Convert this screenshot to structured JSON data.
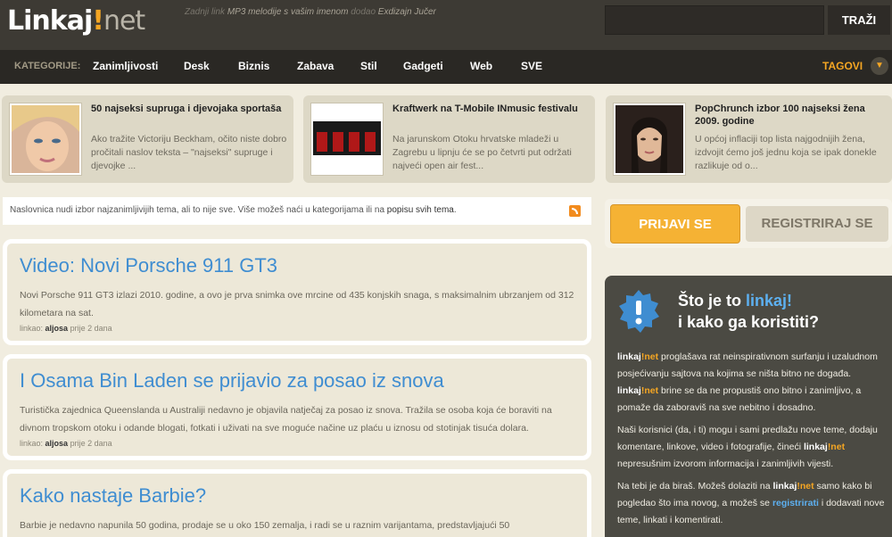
{
  "header": {
    "logo": {
      "part1": "Linkaj",
      "part2": "!",
      "part3": "net"
    },
    "latest": {
      "prefix": "Zadnji link",
      "item": "MP3 melodije s vašim imenom",
      "middle": "dodao",
      "user": "Exdizajn",
      "time": "Jučer"
    },
    "search": {
      "placeholder": "",
      "button_label": "TRAŽI"
    }
  },
  "nav": {
    "label": "KATEGORIJE:",
    "items": [
      "Zanimljivosti",
      "Desk",
      "Biznis",
      "Zabava",
      "Stil",
      "Gadgeti",
      "Web",
      "SVE"
    ],
    "tags_label": "TAGOVI",
    "tags_icon": "chevron-down-icon"
  },
  "featured": [
    {
      "title": "50 najseksi supruga i djevojaka sportaša",
      "desc": "Ako tražite Victoriju Beckham, očito niste dobro pročitali naslov teksta – \"najseksi\" supruge i djevojke ..."
    },
    {
      "title": "Kraftwerk na T-Mobile INmusic festivalu",
      "desc": "Na jarunskom Otoku hrvatske mladeži u Zagrebu u lipnju će se po četvrti put održati najveći open air fest..."
    },
    {
      "title": "PopChrunch izbor 100 najseksi žena 2009. godine",
      "desc": "U općoj inflaciji top lista najgodnijih žena, izdvojit ćemo još jednu koja se ipak donekle razlikuje od o..."
    }
  ],
  "info_bar": {
    "text": "Naslovnica nudi izbor najzanimljivijih tema, ali to nije sve. Više možeš naći u kategorijama ili na",
    "link": "popisu svih tema",
    "end": "."
  },
  "posts": [
    {
      "title": "Video: Novi Porsche 911 GT3",
      "body": "Novi Porsche 911 GT3 izlazi 2010. godine, a ovo je prva snimka ove mrcine od 435 konjskih snaga, s maksimalnim ubrzanjem od 312 kilometara na sat.",
      "meta_prefix": "linkao:",
      "author": "aljosa",
      "time": "prije 2 dana"
    },
    {
      "title": "I Osama Bin Laden se prijavio za posao iz snova",
      "body": "Turistička zajednica Queenslanda u Australiji nedavno je objavila natječaj za posao iz snova. Tražila se osoba koja će boraviti na divnom tropskom otoku i odande blogati, fotkati i uživati na sve moguće načine uz plaću u iznosu od stotinjak tisuća dolara.",
      "meta_prefix": "linkao:",
      "author": "aljosa",
      "time": "prije 2 dana"
    },
    {
      "title": "Kako nastaje Barbie?",
      "body": "Barbie je nedavno napunila 50 godina, prodaje se u oko 150 zemalja, i radi se u raznim varijantama, predstavljajući 50"
    }
  ],
  "auth": {
    "login": "PRIJAVI SE",
    "register": "REGISTRIRAJ SE"
  },
  "whatis": {
    "title_prefix": "Što je to",
    "title_link": "linkaj!",
    "subtitle": "i kako ga koristiti?",
    "brand_a": "linkaj",
    "brand_b": "!net",
    "p1_after": "proglašava rat neinspirativnom surfanju i uzaludnom posjećivanju sajtova na kojima se ništa bitno ne događa.",
    "p1_after2": "brine se da ne propustiš ono bitno i zanimljivo, a pomaže da zaboraviš na sve nebitno i dosadno.",
    "p2": "Naši korisnici (da, i ti) mogu i sami predlažu nove teme, dodaju komentare, linkove, video i fotografije, čineći",
    "p2_after": "nepresušnim izvorom informacija i zanimljivih vijesti.",
    "p3": "Na tebi je da biraš. Možeš dolaziti na",
    "p3_mid": "samo kako bi pogledao što ima novog, a možeš se",
    "p3_link": "registrirati",
    "p3_end": "i dodavati nove teme, linkati i komentirati."
  },
  "colors": {
    "accent": "#f5a623",
    "link": "#3f8dd1",
    "header_bg": "#3d3a34",
    "nav_bg": "#2a2824"
  }
}
